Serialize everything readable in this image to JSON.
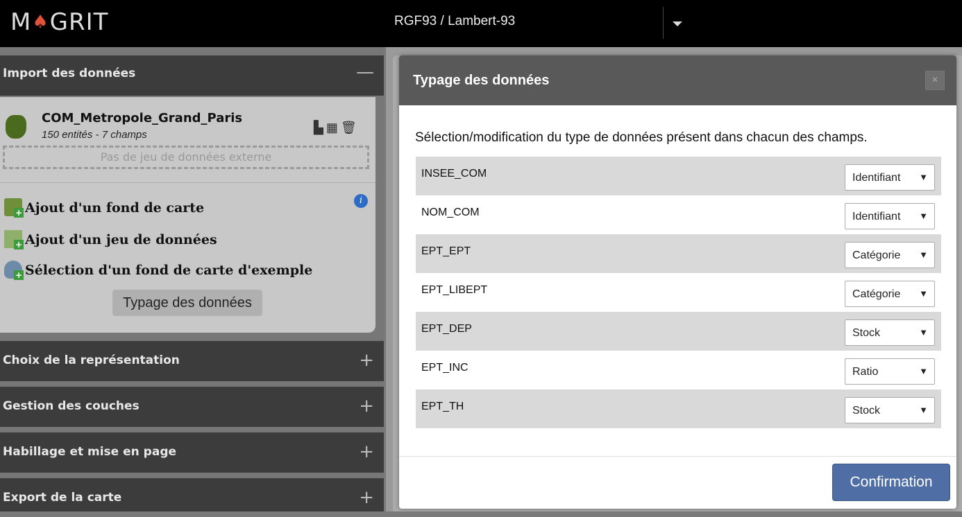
{
  "header": {
    "logo_text": "MAGRIT",
    "projection": "RGF93 / Lambert-93"
  },
  "sidebar": {
    "import_section": {
      "title": "Import des données",
      "collapse_sign": "—",
      "layer": {
        "name": "COM_Metropole_Grand_Paris",
        "info": "150 entités - 7 champs"
      },
      "external_dataset": "Pas de jeu de données externe",
      "actions": [
        {
          "label": "Ajout d'un fond de carte"
        },
        {
          "label": "Ajout d'un jeu de données"
        },
        {
          "label": "Sélection d'un fond de carte d'exemple"
        }
      ],
      "typage_button": "Typage des données"
    },
    "sections": [
      {
        "title": "Choix de la représentation",
        "sign": "+"
      },
      {
        "title": "Gestion des couches",
        "sign": "+"
      },
      {
        "title": "Habillage et mise en page",
        "sign": "+"
      },
      {
        "title": "Export de la carte",
        "sign": "+"
      }
    ]
  },
  "modal": {
    "title": "Typage des données",
    "close": "×",
    "description": "Sélection/modification du type de données présent dans chacun des champs.",
    "fields": [
      {
        "name": "INSEE_COM",
        "type": "Identifiant"
      },
      {
        "name": "NOM_COM",
        "type": "Identifiant"
      },
      {
        "name": "EPT_EPT",
        "type": "Catégorie"
      },
      {
        "name": "EPT_LIBEPT",
        "type": "Catégorie"
      },
      {
        "name": "EPT_DEP",
        "type": "Stock"
      },
      {
        "name": "EPT_INC",
        "type": "Ratio"
      },
      {
        "name": "EPT_TH",
        "type": "Stock"
      }
    ],
    "confirm_label": "Confirmation"
  },
  "icons": {
    "dropdown_arrow": "▼"
  }
}
